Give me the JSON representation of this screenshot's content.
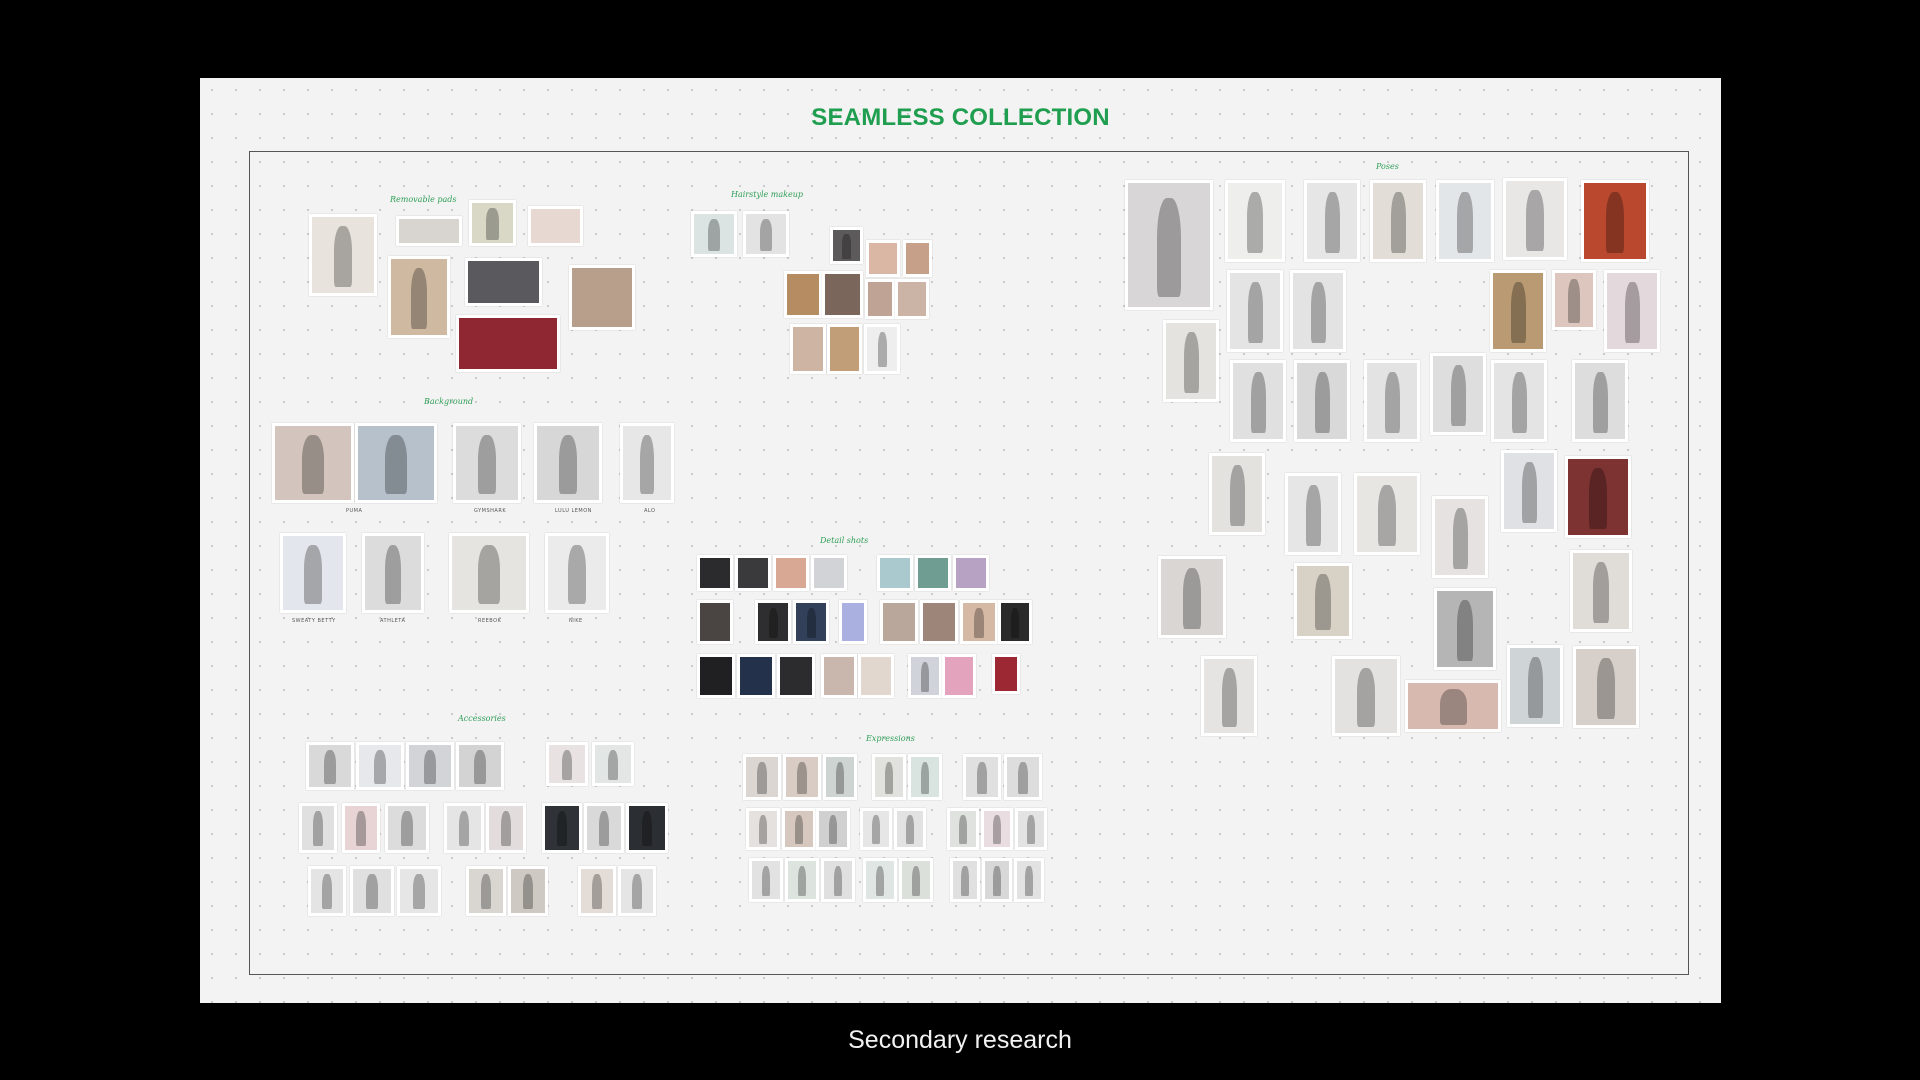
{
  "board": {
    "title": "SEAMLESS COLLECTION",
    "sections": {
      "removable_pads": "Removable pads",
      "hairstyle_makeup": "Hairstyle makeup",
      "background": "Background",
      "detail_shots": "Detail shots",
      "accessories": "Accessories",
      "expressions": "Expressions",
      "poses": "Poses"
    },
    "brand_captions": [
      "PUMA",
      "GYMSHARK",
      "LULU LEMON",
      "ALO",
      "SWEATY BETTY",
      "ATHLETA",
      "REEBOK",
      "NIKE"
    ]
  },
  "caption": "Secondary research",
  "colors": {
    "accent": "#1f9e4f",
    "board_bg": "#f3f3f3",
    "slide_bg": "#000000"
  }
}
